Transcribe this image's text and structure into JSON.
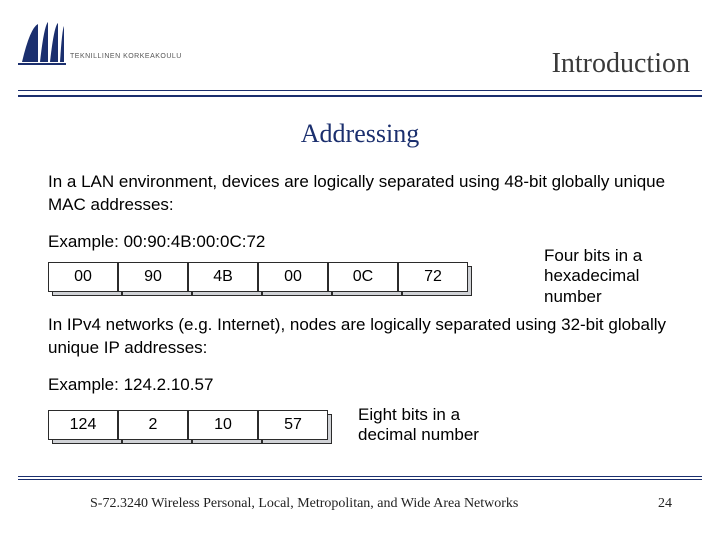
{
  "logo_text": "TEKNILLINEN KORKEAKOULU",
  "header_title": "Introduction",
  "slide_title": "Addressing",
  "para1": "In a LAN environment, devices are logically separated using 48-bit globally unique MAC addresses:",
  "example1_label": "Example:  00:90:4B:00:0C:72",
  "mac_bytes": [
    "00",
    "90",
    "4B",
    "00",
    "0C",
    "72"
  ],
  "note1_l1": "Four bits in a",
  "note1_l2": "hexadecimal",
  "note1_l3": "number",
  "para2": "In IPv4 networks (e.g. Internet), nodes are logically separated using 32-bit globally unique IP addresses:",
  "example2_label": "Example:  124.2.10.57",
  "ip_octets": [
    "124",
    "2",
    "10",
    "57"
  ],
  "note2_l1": "Eight bits in a",
  "note2_l2": "decimal number",
  "footer_course": "S-72.3240 Wireless Personal, Local, Metropolitan, and Wide Area Networks",
  "footer_page": "24"
}
